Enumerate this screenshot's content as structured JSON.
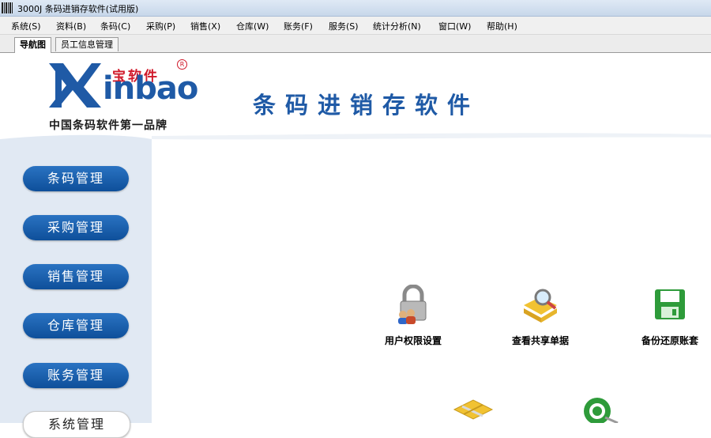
{
  "window": {
    "title": "3000J 条码进销存软件(试用版)"
  },
  "menu": [
    "系统(S)",
    "资料(B)",
    "条码(C)",
    "采购(P)",
    "销售(X)",
    "仓库(W)",
    "账务(F)",
    "服务(S)",
    "统计分析(N)",
    "窗口(W)",
    "帮助(H)"
  ],
  "tabs": [
    {
      "label": "导航图",
      "active": true
    },
    {
      "label": "员工信息管理",
      "active": false
    }
  ],
  "banner": {
    "logo_word": "inbao",
    "logo_cn": "宝软件",
    "logo_reg": "R",
    "slogan": "中国条码软件第一品牌",
    "headline": "条码进销存软件"
  },
  "nav": [
    "条码管理",
    "采购管理",
    "销售管理",
    "仓库管理",
    "账务管理",
    "系统管理"
  ],
  "tiles": [
    {
      "label": "用户权限设置",
      "icon": "lock-users-icon"
    },
    {
      "label": "查看共享单据",
      "icon": "folder-search-icon"
    },
    {
      "label": "备份还原账套",
      "icon": "floppy-disk-icon"
    }
  ],
  "partial_icons": [
    "tools-icon",
    "gear-icon"
  ],
  "colors": {
    "brand_blue": "#1f5aa6",
    "brand_red": "#d0192a",
    "sidebar_bg": "#e1e9f3"
  }
}
